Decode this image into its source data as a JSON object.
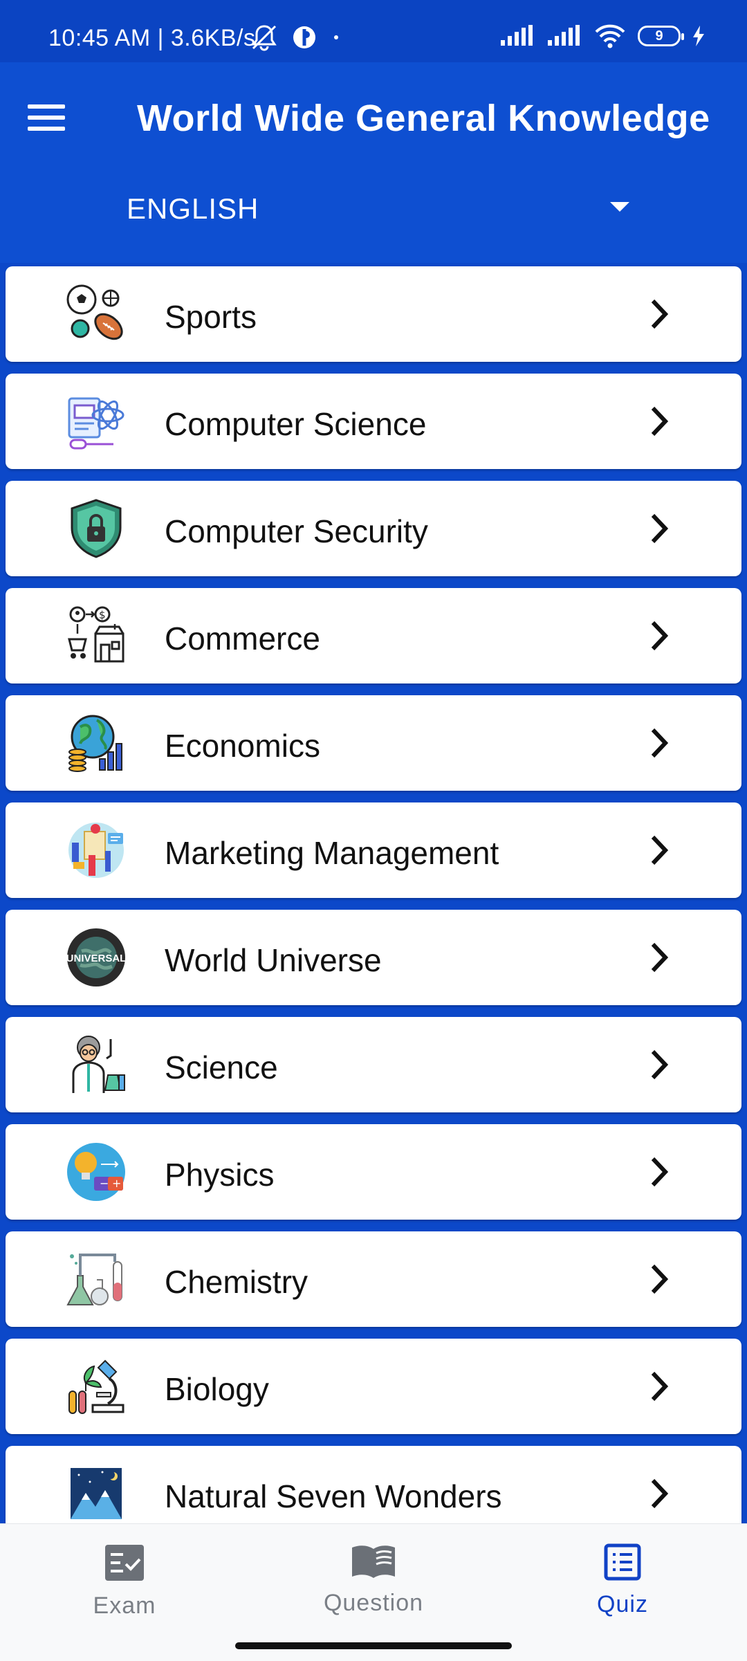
{
  "status": {
    "time_speed": "10:45 AM | 3.6KB/s",
    "battery": "9"
  },
  "header": {
    "title": "World Wide General Knowledge",
    "language": "ENGLISH"
  },
  "categories": [
    {
      "label": "Sports",
      "icon": "sports-icon"
    },
    {
      "label": "Computer Science",
      "icon": "computer-science-icon"
    },
    {
      "label": "Computer Security",
      "icon": "security-shield-lock-icon"
    },
    {
      "label": "Commerce",
      "icon": "commerce-shop-icon"
    },
    {
      "label": "Economics",
      "icon": "economics-globe-coins-icon"
    },
    {
      "label": "Marketing Management",
      "icon": "marketing-icon"
    },
    {
      "label": "World Universe",
      "icon": "universal-globe-icon"
    },
    {
      "label": "Science",
      "icon": "scientist-icon"
    },
    {
      "label": "Physics",
      "icon": "physics-bulb-battery-icon"
    },
    {
      "label": "Chemistry",
      "icon": "chemistry-flask-icon"
    },
    {
      "label": "Biology",
      "icon": "biology-microscope-icon"
    },
    {
      "label": "Natural Seven Wonders",
      "icon": "mountain-night-icon"
    }
  ],
  "universe_logo_text": "UNIVERSAL",
  "bottom_nav": [
    {
      "label": "Exam",
      "icon": "exam-checklist-icon",
      "active": false
    },
    {
      "label": "Question",
      "icon": "open-book-icon",
      "active": false
    },
    {
      "label": "Quiz",
      "icon": "quiz-list-icon",
      "active": true
    }
  ],
  "colors": {
    "primary": "#0e4fd1",
    "statusbar": "#0b44c2",
    "list_background": "#0c48c9",
    "active_nav": "#1142c6",
    "inactive_nav": "#7a7f86"
  }
}
